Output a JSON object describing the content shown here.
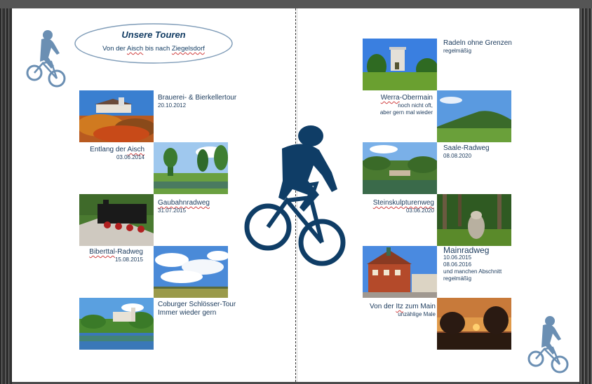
{
  "header": {
    "title": "Unsere Touren",
    "subtitle_pre": "Von der ",
    "subtitle_aisch": "Aisch",
    "subtitle_mid": " bis nach ",
    "subtitle_town": "Ziegelsdorf"
  },
  "left_tours": [
    {
      "title": "Brauerei- & Bierkellertour",
      "date": "20.10.2012"
    },
    {
      "title_a": "Entlang der ",
      "title_b": "Aisch",
      "date": "03.06.2014"
    },
    {
      "title_a": "",
      "title_b": "Gaubahnradweg",
      "date": "31.07.2015"
    },
    {
      "title_a": "Biberttal",
      "title_b": "-Radweg",
      "date": "15.08.2015"
    },
    {
      "title": "Coburger Schlösser-Tour",
      "date": "Immer wieder gern"
    }
  ],
  "right_tours": [
    {
      "title": "Radeln ohne Grenzen",
      "date": "regelmäßig"
    },
    {
      "title_a": "Werra",
      "title_b": "-Obermain",
      "line2": "noch nicht oft,",
      "line3": "aber gern mal wieder"
    },
    {
      "title": "Saale-Radweg",
      "date": "08.08.2020"
    },
    {
      "title_a": "Steinskulpturenweg",
      "date": "03.06.2020"
    },
    {
      "title": "Mainradweg",
      "line1": "10.06.2015",
      "line2": "08.06.2016",
      "line3": "und manchen Abschnitt",
      "line4": "regelmäßig"
    },
    {
      "title_a": "Von der ",
      "title_b": "Itz",
      "title_c": " zum Main",
      "date": "unzählige Male"
    }
  ],
  "colors": {
    "navy": "#123c63",
    "bike_dark": "#0f3d66",
    "bike_light": "#6b8fb3"
  },
  "icons": [
    "cyclist-icon-small-top-left",
    "cyclist-icon-large-center",
    "cyclist-icon-small-bottom-right"
  ]
}
